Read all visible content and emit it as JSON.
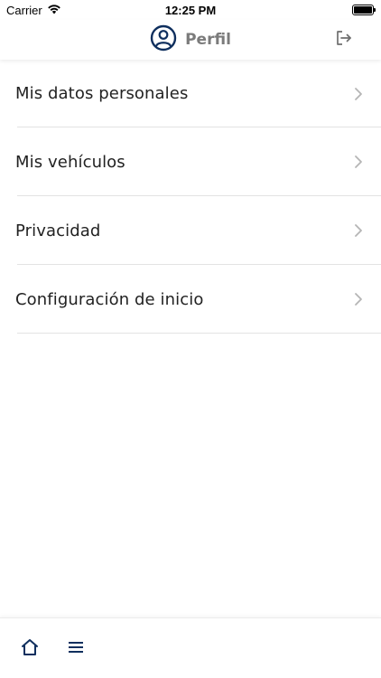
{
  "status_bar": {
    "carrier": "Carrier",
    "time": "12:25 PM",
    "icons": [
      "wifi-icon",
      "battery-icon"
    ]
  },
  "header": {
    "title": "Perfil",
    "icons": {
      "profile": "user-circle-icon",
      "logout": "logout-icon"
    }
  },
  "menu": {
    "items": [
      {
        "label": "Mis datos personales"
      },
      {
        "label": "Mis vehículos"
      },
      {
        "label": "Privacidad"
      },
      {
        "label": "Configuración de inicio"
      }
    ]
  },
  "tab_bar": {
    "items": [
      {
        "icon": "home-icon"
      },
      {
        "icon": "hamburger-menu-icon"
      }
    ]
  },
  "colors": {
    "brand_navy": "#0f2f5e",
    "title_gray": "#7b7b7b",
    "chevron_gray": "#b5b5b5",
    "divider": "#e3e3e3"
  }
}
